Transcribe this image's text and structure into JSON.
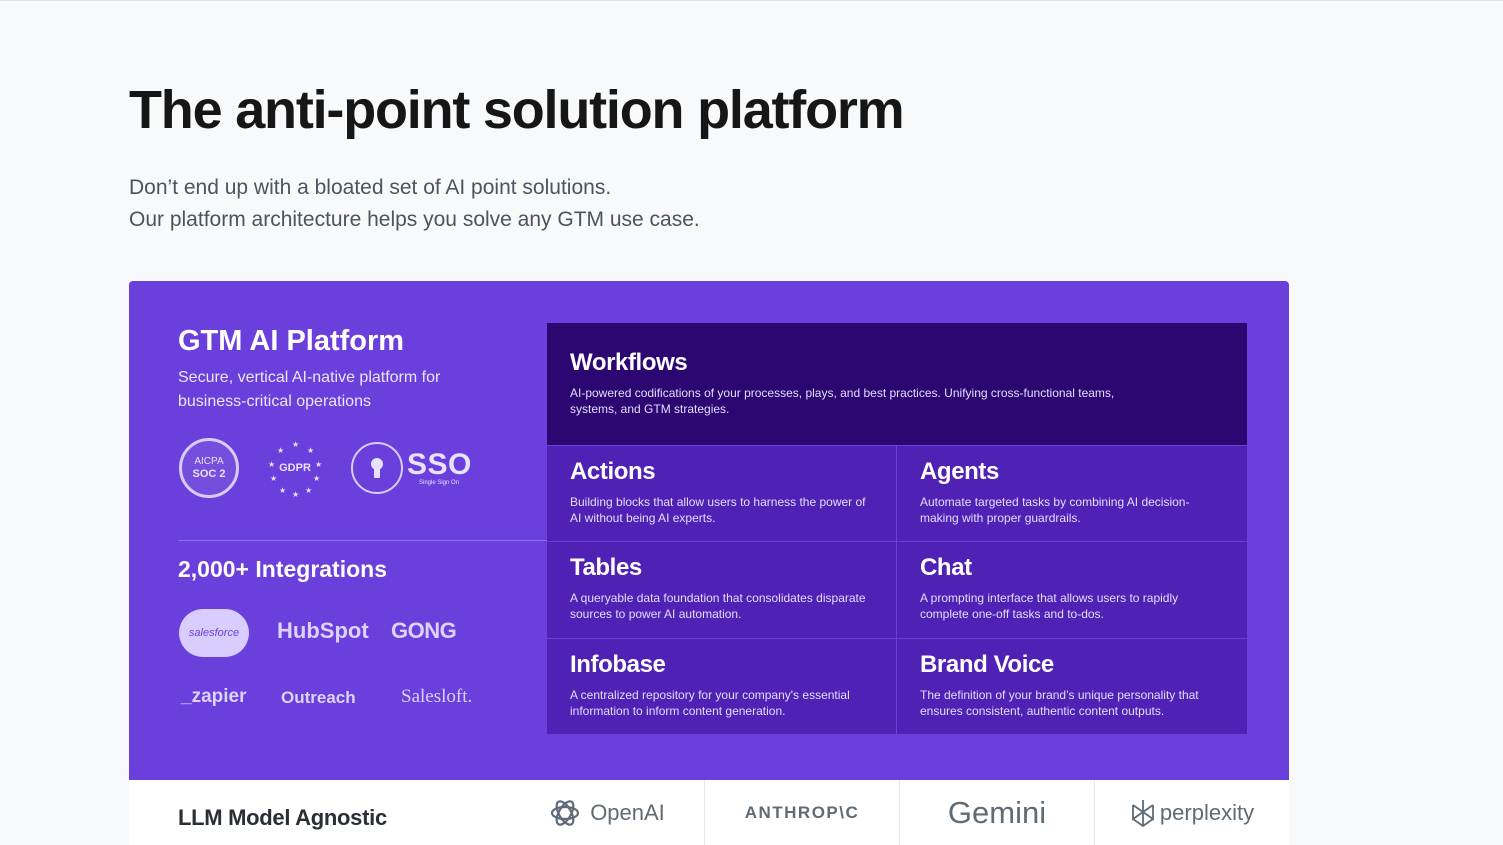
{
  "hero": {
    "title": "The anti-point solution platform",
    "subtitle_line1": "Don’t end up with a bloated set of AI point solutions.",
    "subtitle_line2": "Our platform architecture helps you solve any GTM use case."
  },
  "platform": {
    "title": "GTM AI Platform",
    "subtitle": "Secure, vertical AI-native platform for business-critical operations",
    "badges": {
      "soc_top": "AICPA",
      "soc_main": "SOC 2",
      "gdpr": "GDPR",
      "sso": "SSO",
      "sso_sub": "Single Sign On"
    },
    "integrations_title": "2,000+ Integrations",
    "integrations": [
      "salesforce",
      "HubSpot",
      "GONG",
      "_zapier",
      "Outreach",
      "Salesloft."
    ]
  },
  "features": [
    {
      "title": "Workflows",
      "desc": "AI-powered codifications of your processes, plays, and best practices. Unifying cross-functional teams, systems, and GTM strategies."
    },
    {
      "title": "Actions",
      "desc": "Building blocks that allow users to harness the power of AI without being AI experts."
    },
    {
      "title": "Agents",
      "desc": "Automate targeted tasks by combining  AI decision-making with proper guardrails."
    },
    {
      "title": "Tables",
      "desc": "A queryable data foundation that consolidates disparate sources to power AI automation."
    },
    {
      "title": "Chat",
      "desc": "A prompting interface that allows users to rapidly complete one-off tasks and to-dos."
    },
    {
      "title": "Infobase",
      "desc": "A centralized repository for your company's essential information to inform content generation."
    },
    {
      "title": "Brand Voice",
      "desc": "The definition of your brand’s unique personality that ensures consistent, authentic content outputs."
    }
  ],
  "llm": {
    "title": "LLM Model Agnostic",
    "providers": [
      "OpenAI",
      "ANTHROP\\C",
      "Gemini",
      "perplexity"
    ]
  },
  "colors": {
    "panel": "#6a3fdc",
    "cell": "#4f22b5",
    "cell_featured": "#2c0772",
    "background": "#f7f9fa"
  }
}
